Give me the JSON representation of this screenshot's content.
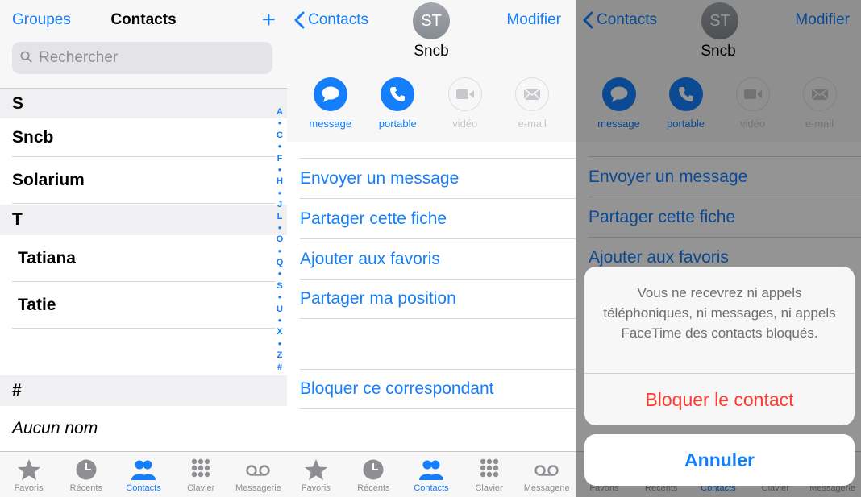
{
  "contacts_screen": {
    "groups_label": "Groupes",
    "title": "Contacts",
    "add_label": "+",
    "search_placeholder": "Rechercher",
    "sections": [
      {
        "letter": "S",
        "items": [
          "Sncb",
          "Solarium"
        ]
      },
      {
        "letter": "T",
        "items": [
          "Tatiana",
          "Tatie"
        ]
      },
      {
        "letter": "#",
        "items": [
          "Aucun nom"
        ]
      }
    ],
    "index": [
      "A",
      "●",
      "C",
      "●",
      "F",
      "●",
      "H",
      "●",
      "J",
      "L",
      "●",
      "O",
      "●",
      "Q",
      "●",
      "S",
      "●",
      "U",
      "●",
      "X",
      "●",
      "Z",
      "#"
    ]
  },
  "tabbar": {
    "tabs": [
      "Favoris",
      "Récents",
      "Contacts",
      "Clavier",
      "Messagerie"
    ],
    "active": "Contacts"
  },
  "contact_screen": {
    "back_label": "Contacts",
    "edit_label": "Modifier",
    "initials": "ST",
    "name": "Sncb",
    "actions": [
      {
        "label": "message",
        "enabled": true
      },
      {
        "label": "portable",
        "enabled": true
      },
      {
        "label": "vidéo",
        "enabled": false
      },
      {
        "label": "e-mail",
        "enabled": false
      }
    ],
    "options": [
      "Envoyer un message",
      "Partager cette fiche",
      "Ajouter aux favoris",
      "Partager ma position"
    ],
    "block_label": "Bloquer ce correspondant"
  },
  "block_sheet": {
    "message": "Vous ne recevrez ni appels téléphoniques, ni messages, ni appels FaceTime des contacts bloqués.",
    "confirm_label": "Bloquer le contact",
    "cancel_label": "Annuler"
  },
  "colors": {
    "accent": "#147EFB",
    "destructive": "#FF3B30",
    "inactive": "#8E8E93"
  }
}
